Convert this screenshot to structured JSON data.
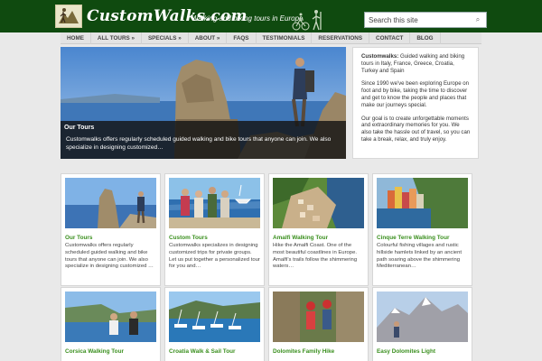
{
  "header": {
    "logo_text": "CustomWalks.com",
    "tagline": "Walking and biking tours in Europe",
    "search_placeholder": "Search this site",
    "search_button": "⌕"
  },
  "nav": {
    "items": [
      {
        "label": "HOME"
      },
      {
        "label": "ALL TOURS »"
      },
      {
        "label": "SPECIALS »"
      },
      {
        "label": "ABOUT »"
      },
      {
        "label": "FAQS"
      },
      {
        "label": "TESTIMONIALS"
      },
      {
        "label": "RESERVATIONS"
      },
      {
        "label": "CONTACT"
      },
      {
        "label": "BLOG"
      }
    ]
  },
  "hero": {
    "title": "Our Tours",
    "text": "Customwalks offers regularly scheduled guided walking and bike tours that anyone can join. We also specialize in designing customized…"
  },
  "about": {
    "brand": "Customwalks:",
    "intro": "Guided walking and biking tours in Italy, France, Greece, Croatia, Turkey and Spain",
    "p2": "Since 1990 we've been exploring Europe on foot and by bike, taking the time to discover and get to know the people and places that make our journeys special.",
    "p3": "Our goal is to create unforgettable moments and extraordinary memories for you. We also take the hassle out of travel, so you can take a break, relax, and truly enjoy."
  },
  "cards": [
    {
      "title": "Our Tours",
      "text": "Customwalks offers regularly scheduled guided walking and bike tours that anyone can join. We also specialize in designing customized …"
    },
    {
      "title": "Custom Tours",
      "text": "Customwalks specializes in designing customized trips for private groups. Let us put together a personalized tour for you and…"
    },
    {
      "title": "Amalfi Walking Tour",
      "text": "Hike the Amalfi Coast. One of the most beautiful coastlines in Europe. Amalfi's trails follow the shimmering waters…"
    },
    {
      "title": "Cinque Terre Walking Tour",
      "text": "Colourful fishing villages and rustic hillside hamlets linked by an ancient path soaring above the shimmering Mediterranean…"
    },
    {
      "title": "Corsica Walking Tour",
      "text": ""
    },
    {
      "title": "Croatia Walk & Sail Tour",
      "text": ""
    },
    {
      "title": "Dolomites Family Hike",
      "text": ""
    },
    {
      "title": "Easy Dolomites Light",
      "text": ""
    }
  ]
}
